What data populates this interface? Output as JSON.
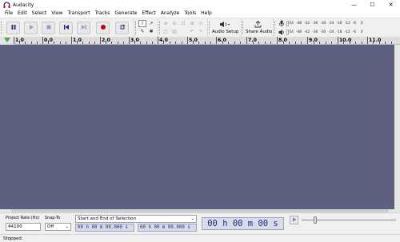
{
  "window": {
    "title": "Audacity",
    "controls": {
      "minimize": "—",
      "maximize": "☐",
      "close": "✕"
    }
  },
  "menu": [
    "File",
    "Edit",
    "Select",
    "View",
    "Transport",
    "Tracks",
    "Generate",
    "Effect",
    "Analyze",
    "Tools",
    "Help"
  ],
  "toolbar": {
    "audio_setup_label": "Audio Setup",
    "share_audio_label": "Share Audio",
    "record_meter_scale": [
      "-54",
      "-48",
      "-42",
      "-36",
      "-30",
      "-24",
      "-18",
      "-12",
      "-6",
      "0"
    ],
    "playback_meter_scale": [
      "-54",
      "-48",
      "-42",
      "-36",
      "-30",
      "-24",
      "-18",
      "-12",
      "-6",
      "0"
    ],
    "accent_colors": {
      "record": "#c0001a",
      "transport": "#1e2a78",
      "track_background": "#5e6080"
    }
  },
  "ruler": {
    "labels": [
      "1.0",
      "0.0",
      "1.0",
      "2.0",
      "3.0",
      "4.0",
      "5.0",
      "6.0",
      "7.0",
      "8.0",
      "9.0",
      "10.0",
      "11.0"
    ]
  },
  "selection_toolbar": {
    "project_rate_label": "Project Rate (Hz)",
    "project_rate_value": "44100",
    "snap_to_label": "Snap-To",
    "snap_to_value": "Off",
    "selection_mode_value": "Start and End of Selection",
    "selection_start": "00 h 00 m 00.000 s",
    "selection_end": "00 h 00 m 00.000 s",
    "audio_position": "00 h 00 m 00 s"
  },
  "status": {
    "text": "Stopped."
  }
}
